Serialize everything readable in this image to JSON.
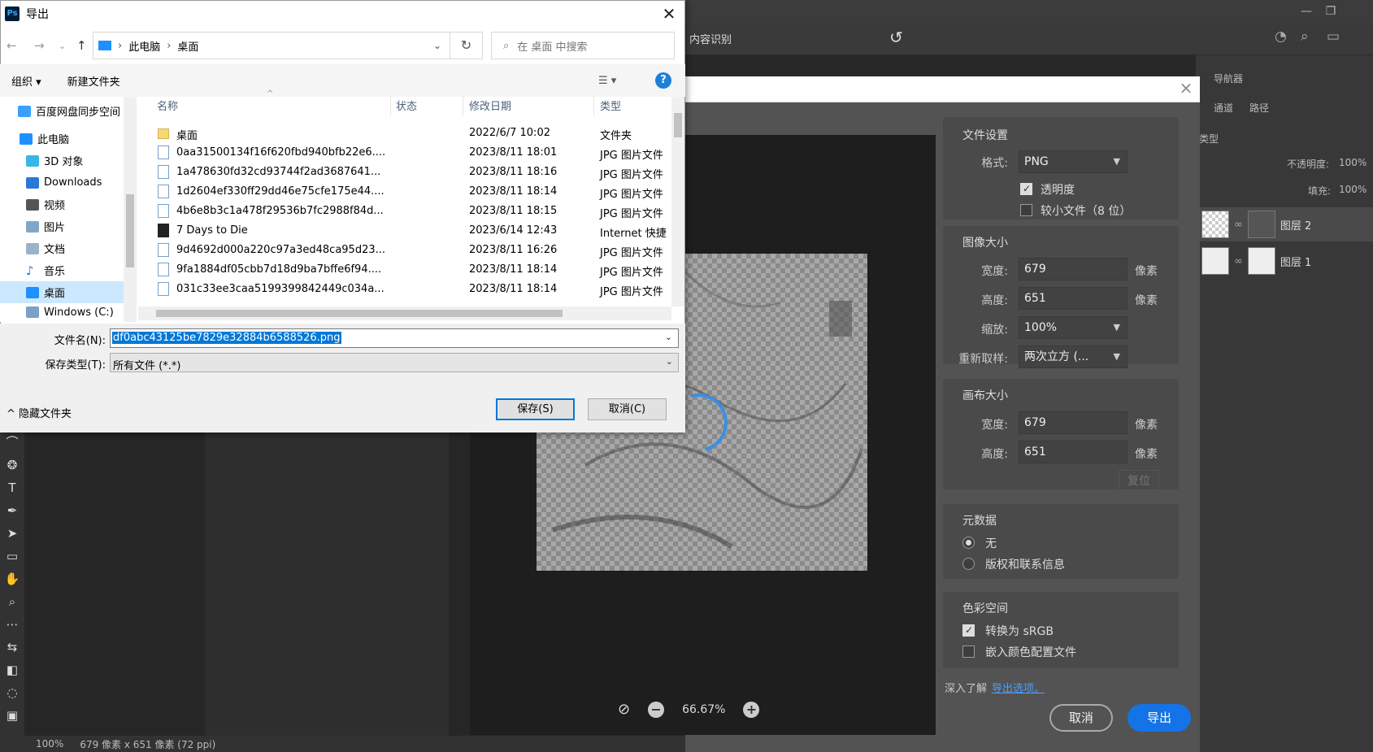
{
  "win_dialog": {
    "title": "导出",
    "address": [
      "此电脑",
      "桌面"
    ],
    "search_placeholder": "在 桌面 中搜索",
    "organize": "组织 ▾",
    "new_folder": "新建文件夹",
    "nav": [
      {
        "label": "百度网盘同步空间",
        "icon": "cloud-icon"
      },
      {
        "label": "此电脑",
        "icon": "computer-icon"
      },
      {
        "label": "3D 对象",
        "icon": "cube-icon"
      },
      {
        "label": "Downloads",
        "icon": "download-icon"
      },
      {
        "label": "视频",
        "icon": "video-icon"
      },
      {
        "label": "图片",
        "icon": "picture-icon"
      },
      {
        "label": "文档",
        "icon": "document-icon"
      },
      {
        "label": "音乐",
        "icon": "music-icon"
      },
      {
        "label": "桌面",
        "icon": "desktop-icon",
        "selected": true
      },
      {
        "label": "Windows (C:)",
        "icon": "drive-icon"
      }
    ],
    "columns": [
      "名称",
      "状态",
      "修改日期",
      "类型"
    ],
    "files": [
      {
        "name": "桌面",
        "date": "2022/6/7 10:02",
        "type": "文件夹",
        "kind": "folder"
      },
      {
        "name": "0aa31500134f16f620fbd940bfb22e6....",
        "date": "2023/8/11 18:01",
        "type": "JPG 图片文件",
        "kind": "jpg"
      },
      {
        "name": "1a478630fd32cd93744f2ad3687641...",
        "date": "2023/8/11 18:16",
        "type": "JPG 图片文件",
        "kind": "jpg"
      },
      {
        "name": "1d2604ef330ff29dd46e75cfe175e44....",
        "date": "2023/8/11 18:14",
        "type": "JPG 图片文件",
        "kind": "jpg"
      },
      {
        "name": "4b6e8b3c1a478f29536b7fc2988f84d...",
        "date": "2023/8/11 18:15",
        "type": "JPG 图片文件",
        "kind": "jpg"
      },
      {
        "name": "7 Days to Die",
        "date": "2023/6/14 12:43",
        "type": "Internet 快捷",
        "kind": "game"
      },
      {
        "name": "9d4692d000a220c97a3ed48ca95d23...",
        "date": "2023/8/11 16:26",
        "type": "JPG 图片文件",
        "kind": "jpg"
      },
      {
        "name": "9fa1884df05cbb7d18d9ba7bffe6f94....",
        "date": "2023/8/11 18:14",
        "type": "JPG 图片文件",
        "kind": "jpg"
      },
      {
        "name": "031c33ee3caa5199399842449c034a...",
        "date": "2023/8/11 18:14",
        "type": "JPG 图片文件",
        "kind": "jpg"
      }
    ],
    "filename_label": "文件名(N):",
    "filename_value": "df0abc43125be7829e32884b6588526.png",
    "filetype_label": "保存类型(T):",
    "filetype_value": "所有文件 (*.*)",
    "hide_folders": "隐藏文件夹",
    "save": "保存(S)",
    "cancel": "取消(C)"
  },
  "ps": {
    "options_text": "内容识别",
    "panel_tabs": [
      "导航器",
      "通道",
      "路径"
    ],
    "layer_kind": "类型",
    "opacity_label": "不透明度:",
    "opacity_value": "100%",
    "fill_label": "填充:",
    "fill_value": "100%",
    "layers": [
      "图层 2",
      "图层 1"
    ],
    "status_zoom": "100%",
    "status_size": "679 像素 x 651 像素 (72 ppi)"
  },
  "export": {
    "file_settings_title": "文件设置",
    "format_label": "格式:",
    "format_value": "PNG",
    "transparency": "透明度",
    "transparency_checked": true,
    "smaller_file": "较小文件（8 位）",
    "smaller_checked": false,
    "image_size_title": "图像大小",
    "width_label": "宽度:",
    "width_value": "679",
    "height_label": "高度:",
    "height_value": "651",
    "unit": "像素",
    "scale_label": "缩放:",
    "scale_value": "100%",
    "resample_label": "重新取样:",
    "resample_value": "两次立方 (...",
    "canvas_size_title": "画布大小",
    "canvas_width": "679",
    "canvas_height": "651",
    "reset": "复位",
    "metadata_title": "元数据",
    "meta_none": "无",
    "meta_copyright": "版权和联系信息",
    "color_space_title": "色彩空间",
    "convert_srgb": "转换为 sRGB",
    "embed_profile": "嵌入颜色配置文件",
    "learn_more": "深入了解",
    "export_options_link": "导出选项。",
    "zoom_level": "66.67%",
    "cancel": "取消",
    "export": "导出",
    "accent": "#1473e6"
  }
}
